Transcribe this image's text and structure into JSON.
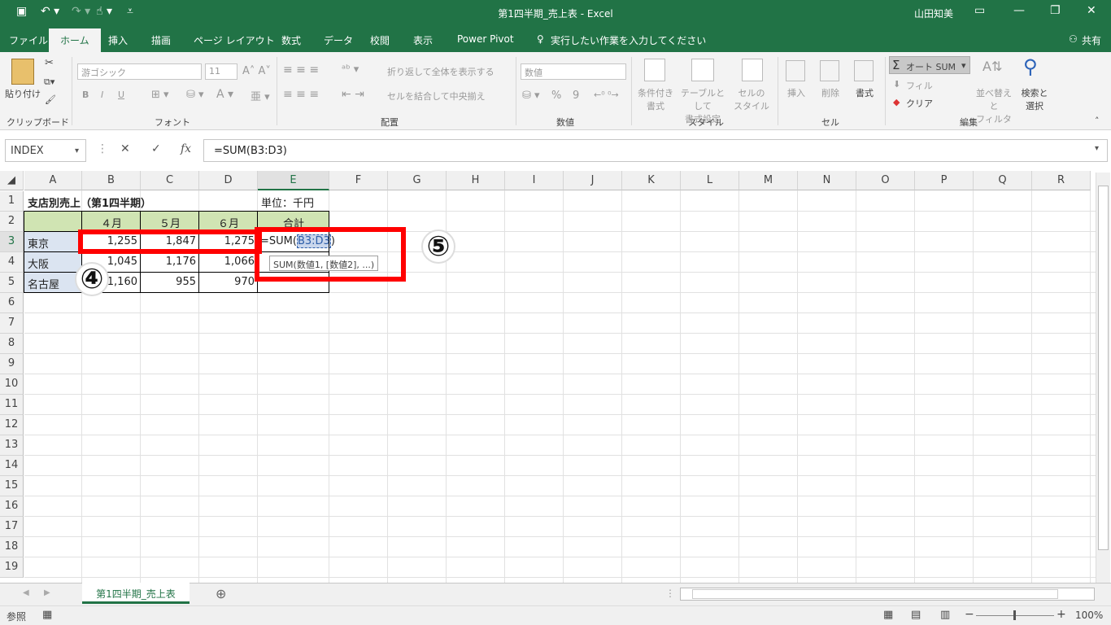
{
  "window": {
    "title": "第1四半期_売上表 - Excel",
    "user": "山田知美"
  },
  "quick_access": {
    "save_icon": "save-icon",
    "undo_icon": "undo-icon",
    "redo_icon": "redo-icon",
    "touch_icon": "touch-mode-icon"
  },
  "ribbon_tabs": [
    "ファイル",
    "ホーム",
    "挿入",
    "描画",
    "ページ レイアウト",
    "数式",
    "データ",
    "校閲",
    "表示",
    "Power Pivot"
  ],
  "tell_me": "実行したい作業を入力してください",
  "share": "共有",
  "ribbon": {
    "clipboard": {
      "paste": "貼り付け",
      "label": "クリップボード"
    },
    "font": {
      "font_name": "游ゴシック",
      "font_size": "11",
      "bold": "B",
      "italic": "I",
      "underline": "U",
      "label": "フォント"
    },
    "alignment": {
      "wrap": "折り返して全体を表示する",
      "merge": "セルを結合して中央揃え",
      "label": "配置"
    },
    "number": {
      "format": "数値",
      "percent": "%",
      "comma": "9",
      "label": "数値"
    },
    "styles": {
      "conditional": "条件付き\n書式",
      "table": "テーブルとして\n書式設定",
      "cell": "セルの\nスタイル",
      "label": "スタイル"
    },
    "cells": {
      "insert": "挿入",
      "delete": "削除",
      "format": "書式",
      "label": "セル"
    },
    "editing": {
      "autosum": "オート SUM",
      "fill": "フィル",
      "clear": "クリア",
      "sort": "並べ替えと\nフィルター",
      "find": "検索と\n選択",
      "label": "編集"
    }
  },
  "formula_bar": {
    "name_box": "INDEX",
    "formula": "=SUM(B3:D3)",
    "fx": "fx",
    "cancel": "✕",
    "enter": "✓"
  },
  "columns": [
    "A",
    "B",
    "C",
    "D",
    "E",
    "F",
    "G",
    "H",
    "I",
    "J",
    "K",
    "L",
    "M",
    "N",
    "O",
    "P",
    "Q",
    "R"
  ],
  "rows": [
    "1",
    "2",
    "3",
    "4",
    "5",
    "6",
    "7",
    "8",
    "9",
    "10",
    "11",
    "12",
    "13",
    "14",
    "15",
    "16",
    "17",
    "18",
    "19"
  ],
  "cells": {
    "A1": "支店別売上（第1四半期）",
    "E1": "単位：千円",
    "B2": "４月",
    "C2": "５月",
    "D2": "６月",
    "E2": "合計",
    "A3": "東京",
    "B3": "1,255",
    "C3": "1,847",
    "D3": "1,275",
    "A4": "大阪",
    "B4": "1,045",
    "C4": "1,176",
    "D4": "1,066",
    "A5": "名古屋",
    "B5": "1,160",
    "C5": "955",
    "D5": "970"
  },
  "editing_cell": {
    "prefix": "=SUM(",
    "ref": "B3:D3",
    "suffix": ")"
  },
  "tooltip": "SUM(数値1, [数値2], ...)",
  "annotations": {
    "step4": "④",
    "step5": "⑤"
  },
  "sheet_tab": "第1四半期_売上表",
  "status": {
    "mode": "参照",
    "zoom": "100%"
  }
}
